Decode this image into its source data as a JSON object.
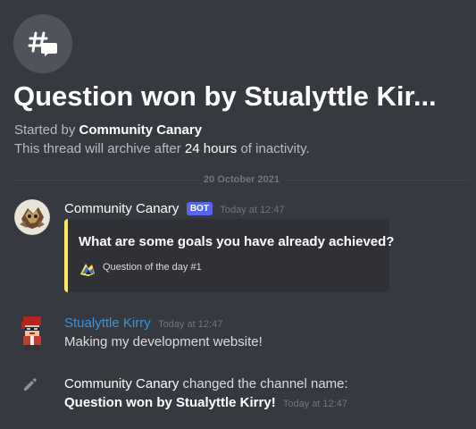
{
  "thread": {
    "icon": "threads-hash-icon",
    "title": "Question won by Stualyttle Kir...",
    "started_prefix": "Started by",
    "started_by": "Community Canary",
    "archive_prefix": "This thread will archive after",
    "archive_duration": "24 hours",
    "archive_suffix": "of inactivity."
  },
  "divider": {
    "date": "20 October 2021"
  },
  "messages": [
    {
      "author": "Community Canary",
      "bot_tag": "BOT",
      "timestamp": "Today at 12:47",
      "avatar": "canary-avatar",
      "embed": {
        "title": "What are some goals you have already achieved?",
        "footer": "Question of the day #1",
        "footer_icon": "canary-icon",
        "color": "#fee75c"
      }
    },
    {
      "author": "Stualyttle Kirry",
      "timestamp": "Today at 12:47",
      "avatar": "pixel-avatar",
      "text": "Making my development website!",
      "author_color": "#3498db"
    }
  ],
  "system_message": {
    "icon": "pencil-icon",
    "actor": "Community Canary",
    "action": "changed the channel name:",
    "new_name": "Question won by Stualyttle Kirry!",
    "timestamp": "Today at 12:47"
  },
  "colors": {
    "background": "#36393f",
    "bot_tag": "#5865f2",
    "embed_bg": "#2f3136"
  }
}
